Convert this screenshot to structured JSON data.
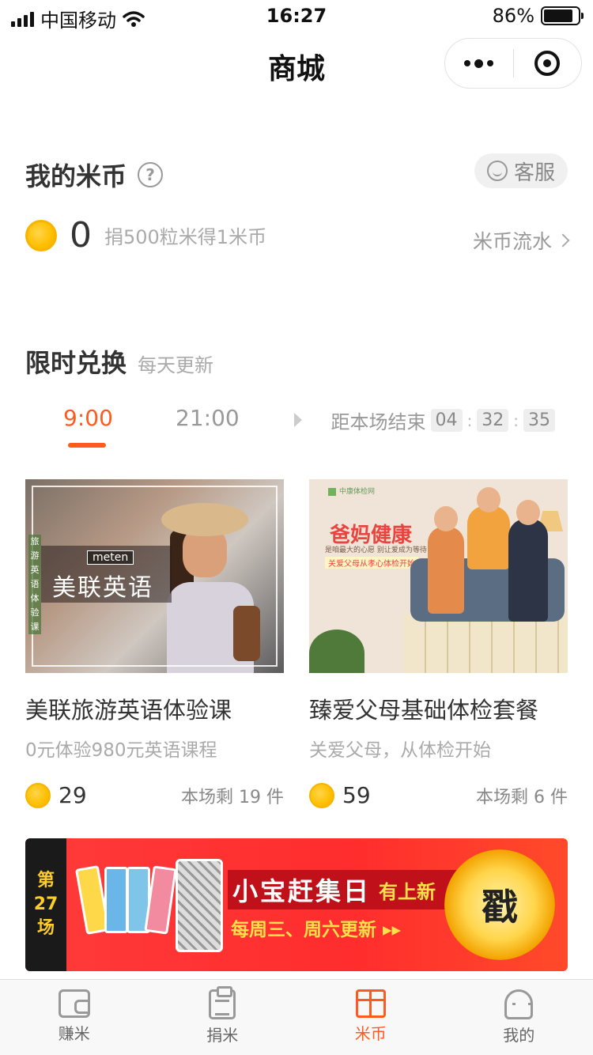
{
  "status_bar": {
    "carrier": "中国移动",
    "time": "16:27",
    "battery_percent": "86%",
    "battery_level": 0.86
  },
  "nav": {
    "title": "商城"
  },
  "coins": {
    "title": "我的米币",
    "help_icon": "question-circle-icon",
    "service_label": "客服",
    "amount": "0",
    "tip": "捐500粒米得1米币",
    "flow_link": "米币流水"
  },
  "exchange": {
    "title": "限时兑换",
    "subtitle": "每天更新",
    "tabs": [
      {
        "label": "9:00",
        "active": true
      },
      {
        "label": "21:00",
        "active": false
      }
    ],
    "countdown_label": "距本场结束",
    "countdown": {
      "h": "04",
      "m": "32",
      "s": "35"
    },
    "products": [
      {
        "name": "美联旅游英语体验课",
        "desc": "0元体验980元英语课程",
        "price": "29",
        "remain": "本场剩 19 件",
        "image_text": {
          "logo": "meten",
          "brand": "美联英语",
          "vertical": "旅游英语体验课"
        }
      },
      {
        "name": "臻爱父母基础体检套餐",
        "desc": "关爱父母，从体检开始",
        "price": "59",
        "remain": "本场剩 6 件",
        "image_text": {
          "logo": "中康体检网",
          "headline": "爸妈健康",
          "line1": "是咱最大的心愿  别让爱成为等待",
          "line2": "关爱父母从孝心体检开始"
        }
      }
    ]
  },
  "banner": {
    "round_1": "第",
    "round_2": "27",
    "round_3": "场",
    "title": "小宝赶集日",
    "badge": "有上新",
    "subtitle": "每周三、周六更新 ▸▸",
    "stamp": "戳",
    "colors": {
      "bg": "#ff2d2d",
      "accent": "#ffe04a"
    }
  },
  "tabbar": {
    "items": [
      {
        "label": "赚米",
        "icon": "wallet-icon"
      },
      {
        "label": "捐米",
        "icon": "clipboard-icon"
      },
      {
        "label": "米币",
        "icon": "gift-icon"
      },
      {
        "label": "我的",
        "icon": "profile-icon"
      }
    ],
    "active_index": 2,
    "active_color": "#ff5a1f"
  }
}
